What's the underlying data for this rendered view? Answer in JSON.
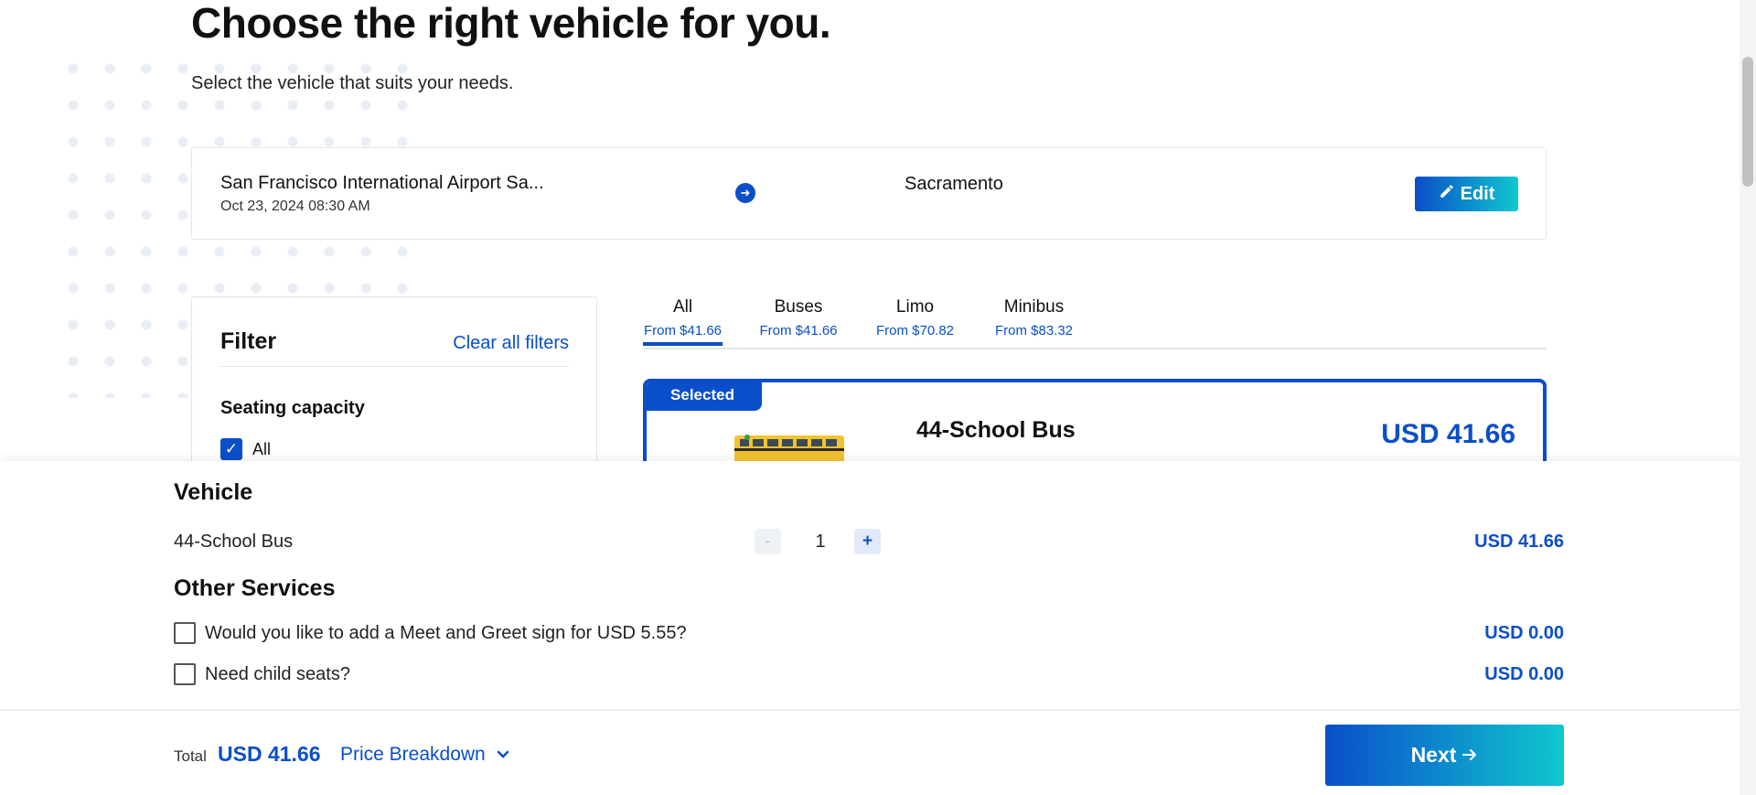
{
  "page": {
    "title": "Choose the right vehicle for you.",
    "subtitle": "Select the vehicle that suits your needs."
  },
  "route": {
    "from": "San Francisco International Airport Sa...",
    "date": "Oct 23, 2024 08:30 AM",
    "arrow_icon": "arrow-right-circle-icon",
    "to": "Sacramento",
    "edit_label": "Edit",
    "edit_icon": "pencil-icon"
  },
  "filter": {
    "title": "Filter",
    "clear_label": "Clear all filters",
    "seating_title": "Seating capacity",
    "all_label": "All",
    "all_checked": true
  },
  "tabs": [
    {
      "name": "All",
      "price": "From $41.66",
      "active": true
    },
    {
      "name": "Buses",
      "price": "From $41.66",
      "active": false
    },
    {
      "name": "Limo",
      "price": "From $70.82",
      "active": false
    },
    {
      "name": "Minibus",
      "price": "From $83.32",
      "active": false
    }
  ],
  "vehicle_card": {
    "badge": "Selected",
    "name": "44-School Bus",
    "price": "USD 41.66",
    "image_icon": "school-bus-image"
  },
  "summary": {
    "vehicle_title": "Vehicle",
    "vehicle_name": "44-School Bus",
    "qty_minus": "-",
    "quantity": "1",
    "qty_plus": "+",
    "vehicle_price": "USD 41.66",
    "other_title": "Other Services",
    "services": [
      {
        "label": "Would you like to add a Meet and Greet sign for USD 5.55?",
        "price": "USD 0.00",
        "checked": false
      },
      {
        "label": "Need child seats?",
        "price": "USD 0.00",
        "checked": false
      }
    ]
  },
  "footer": {
    "total_label": "Total",
    "total_value": "USD 41.66",
    "price_breakdown": "Price Breakdown",
    "chevron_icon": "chevron-down-icon",
    "next_label": "Next",
    "next_icon": "arrow-right-icon"
  },
  "colors": {
    "accent": "#0a4fc9",
    "gradient_end": "#0fc7cf"
  }
}
